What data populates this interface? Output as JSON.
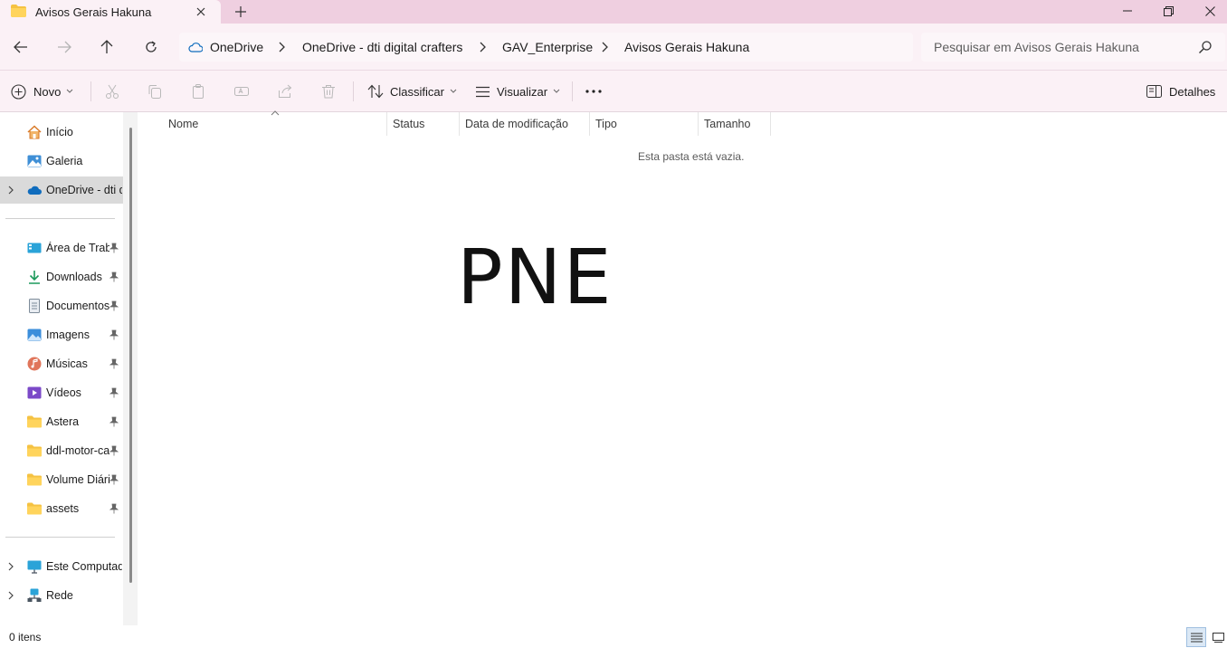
{
  "tab": {
    "title": "Avisos Gerais Hakuna"
  },
  "breadcrumb": [
    "OneDrive",
    "OneDrive - dti digital crafters",
    "GAV_Enterprise",
    "Avisos Gerais Hakuna"
  ],
  "search": {
    "placeholder": "Pesquisar em Avisos Gerais Hakuna"
  },
  "toolbar": {
    "new_label": "Novo",
    "sort_label": "Classificar",
    "view_label": "Visualizar",
    "details_label": "Detalhes"
  },
  "sidebar": {
    "top": [
      {
        "label": "Início",
        "icon": "home-icon"
      },
      {
        "label": "Galeria",
        "icon": "gallery-icon"
      },
      {
        "label": "OneDrive - dti d",
        "icon": "onedrive-icon"
      }
    ],
    "quick": [
      {
        "label": "Área de Trab",
        "icon": "desktop-icon"
      },
      {
        "label": "Downloads",
        "icon": "download-icon"
      },
      {
        "label": "Documentos",
        "icon": "document-icon"
      },
      {
        "label": "Imagens",
        "icon": "pictures-icon"
      },
      {
        "label": "Músicas",
        "icon": "music-icon"
      },
      {
        "label": "Vídeos",
        "icon": "video-icon"
      },
      {
        "label": "Astera",
        "icon": "folder-icon"
      },
      {
        "label": "ddl-motor-ca",
        "icon": "folder-icon"
      },
      {
        "label": "Volume Diári",
        "icon": "folder-icon"
      },
      {
        "label": "assets",
        "icon": "folder-icon"
      }
    ],
    "bottom": [
      {
        "label": "Este Computador",
        "icon": "computer-icon"
      },
      {
        "label": "Rede",
        "icon": "network-icon"
      }
    ]
  },
  "columns": [
    "Nome",
    "Status",
    "Data de modificação",
    "Tipo",
    "Tamanho"
  ],
  "empty_message": "Esta pasta está vazia.",
  "overlay_text": "PNE",
  "status": {
    "item_count": "0 itens"
  },
  "colors": {
    "titlebar": "#efcfe0",
    "chrome": "#fbf1f6",
    "folder": "#f5c242",
    "onedrive": "#0f6cbd"
  }
}
